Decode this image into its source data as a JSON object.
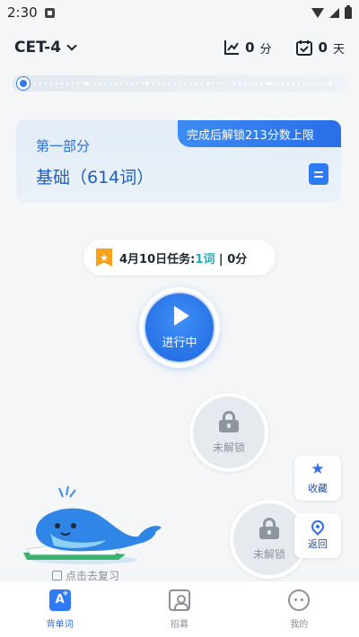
{
  "status_bar": {
    "time": "2:30"
  },
  "header": {
    "level": "CET-4",
    "score": "0",
    "score_unit": "分",
    "days": "0",
    "days_unit": "天"
  },
  "progress": {
    "value": 0
  },
  "section": {
    "unlock_banner": "完成后解锁213分数上限",
    "part": "第一部分",
    "title": "基础（614词）"
  },
  "task": {
    "badge_icon": "bookmark-star-icon",
    "date_label": "4月10日任务: ",
    "words": "1词",
    "rest": " | 0分"
  },
  "nodes": {
    "active_label": "进行中",
    "locked_label_1": "未解锁",
    "locked_label_2": "未解锁"
  },
  "side_buttons": {
    "favorite": "收藏",
    "back": "返回"
  },
  "review": {
    "label": "点击去复习"
  },
  "tabs": [
    {
      "label": "背单词",
      "icon": "A+"
    },
    {
      "label": "招募"
    },
    {
      "label": "我的"
    }
  ],
  "colors": {
    "accent": "#2f7bf5",
    "banner": "#2a6ee8",
    "task_highlight": "#18b0bb",
    "badge": "#f7a21a"
  }
}
